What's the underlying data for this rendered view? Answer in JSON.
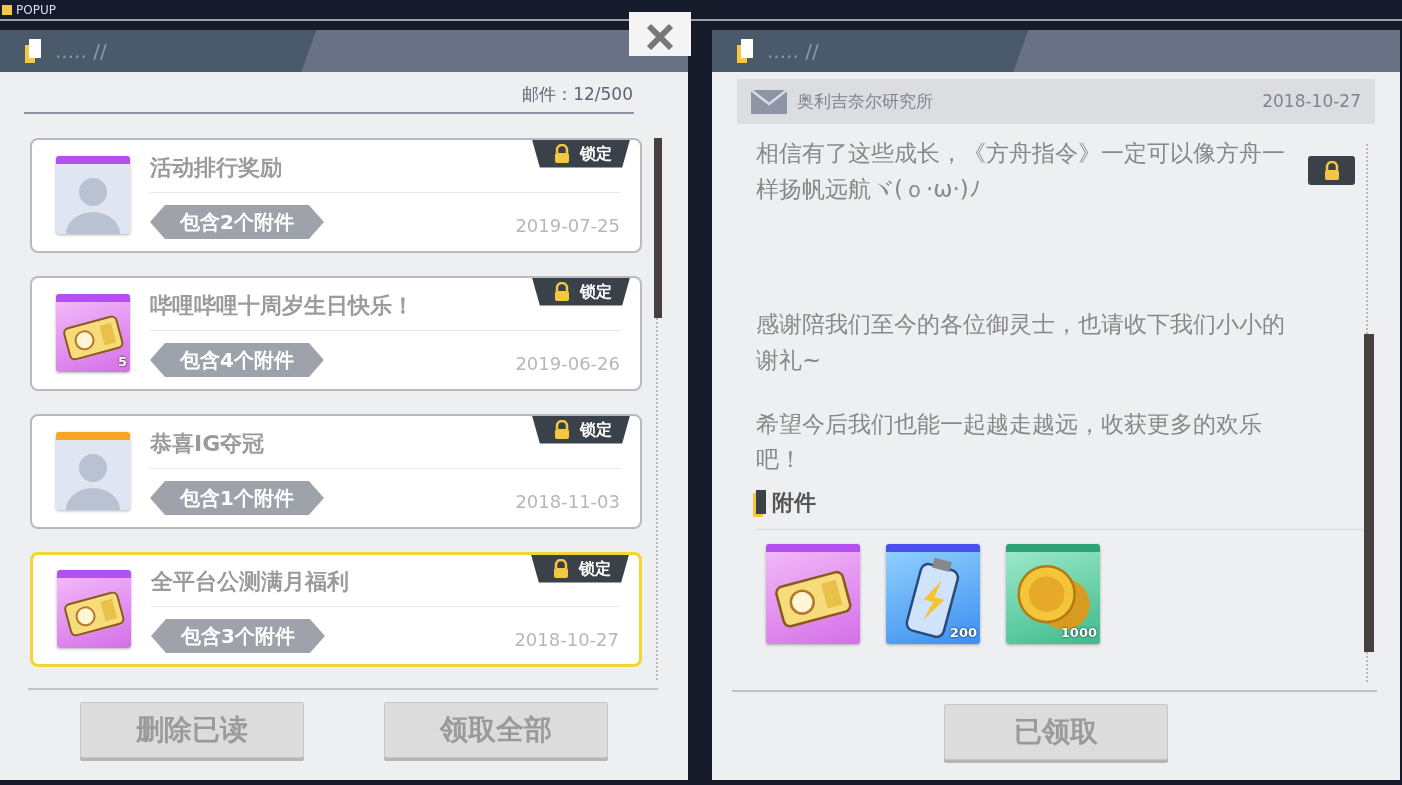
{
  "top_bar": {
    "label": "POPUP"
  },
  "mail_list": {
    "header": "..... //",
    "count": "邮件：12/500",
    "items": [
      {
        "title": "活动排行奖励",
        "attachments": "包含2个附件",
        "date": "2019-07-25",
        "locked": true,
        "lock_label": "锁定",
        "selected": false,
        "icon": {
          "kind": "avatar",
          "color": "#b44ff0"
        }
      },
      {
        "title": "哔哩哔哩十周岁生日快乐！",
        "attachments": "包含4个附件",
        "date": "2019-06-26",
        "locked": true,
        "lock_label": "锁定",
        "selected": false,
        "icon": {
          "kind": "ticket",
          "color": "#b44ff0",
          "count": "5"
        }
      },
      {
        "title": "恭喜IG夺冠",
        "attachments": "包含1个附件",
        "date": "2018-11-03",
        "locked": true,
        "lock_label": "锁定",
        "selected": false,
        "icon": {
          "kind": "avatar",
          "color": "#f5a623"
        }
      },
      {
        "title": "全平台公测满月福利",
        "attachments": "包含3个附件",
        "date": "2018-10-27",
        "locked": true,
        "lock_label": "锁定",
        "selected": true,
        "icon": {
          "kind": "ticket",
          "color": "#b44ff0"
        }
      }
    ],
    "buttons": [
      "删除已读",
      "领取全部"
    ]
  },
  "mail_detail": {
    "header": "..... //",
    "sender": "奥利吉奈尔研究所",
    "date": "2018-10-27",
    "locked": true,
    "paragraphs": [
      "相信有了这些成长，《方舟指令》一定可以像方舟一样扬帆远航ヾ(ｏ·ω·)ﾉ",
      "感谢陪我们至今的各位御灵士，也请收下我们小小的谢礼~",
      "希望今后我们也能一起越走越远，收获更多的欢乐吧！"
    ],
    "attachments_title": "附件",
    "attachments": [
      {
        "kind": "ticket",
        "color": "#b44ff0"
      },
      {
        "kind": "battery",
        "color": "#4a4ff0",
        "count": "200"
      },
      {
        "kind": "coins",
        "color": "#2fa27a",
        "count": "1000"
      }
    ],
    "button": "已领取"
  }
}
